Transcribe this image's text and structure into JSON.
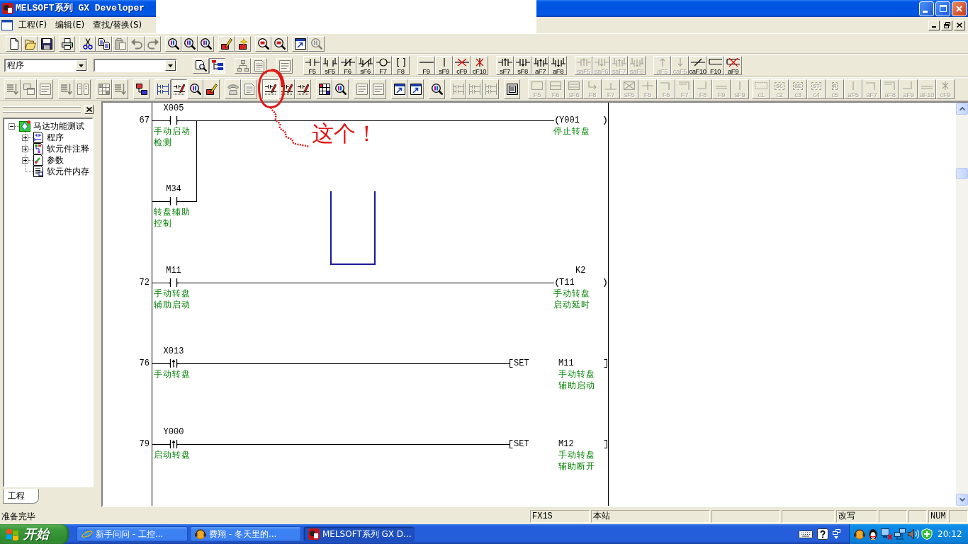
{
  "window": {
    "title": "MELSOFT系列 GX Developer"
  },
  "menu": [
    {
      "label": "工程(F)"
    },
    {
      "label": "编辑(E)"
    },
    {
      "label": "查找/替换(S)"
    }
  ],
  "toolbar_1": [
    [
      {
        "kind": "page",
        "disabled": false,
        "pressed": false
      },
      {
        "kind": "folder",
        "disabled": false,
        "pressed": false
      },
      {
        "kind": "floppy",
        "disabled": false,
        "pressed": false
      }
    ],
    [
      {
        "kind": "printer",
        "disabled": false,
        "pressed": false
      }
    ],
    [
      {
        "kind": "scissors",
        "disabled": false,
        "pressed": false
      },
      {
        "kind": "copy",
        "disabled": false,
        "pressed": false
      },
      {
        "kind": "clipboard",
        "disabled": true,
        "pressed": false
      },
      {
        "kind": "undo",
        "disabled": true,
        "pressed": false
      },
      {
        "kind": "redo",
        "disabled": true,
        "pressed": false
      }
    ],
    [
      {
        "kind": "find",
        "disabled": false,
        "pressed": false
      },
      {
        "kind": "find",
        "disabled": false,
        "pressed": false
      },
      {
        "kind": "find",
        "disabled": false,
        "pressed": false
      }
    ],
    [
      {
        "kind": "box-pencil",
        "disabled": false,
        "pressed": false
      },
      {
        "kind": "box-sparkle",
        "disabled": false,
        "pressed": false
      }
    ],
    [
      {
        "kind": "zoom",
        "disabled": false,
        "pressed": false
      },
      {
        "kind": "zoom",
        "disabled": false,
        "pressed": false
      }
    ],
    [
      {
        "kind": "window-arrow",
        "disabled": false,
        "pressed": false
      },
      {
        "kind": "find",
        "disabled": true,
        "pressed": false
      }
    ]
  ],
  "toolbar_2": {
    "dropdowns": [
      {
        "value": "程序"
      }
    ],
    "tools": [
      [
        {
          "kind": "page-magnifier",
          "disabled": false,
          "pressed": false
        },
        {
          "kind": "tree",
          "disabled": false,
          "pressed": true
        }
      ],
      [
        {
          "kind": "network",
          "disabled": true,
          "pressed": false
        },
        {
          "kind": "document",
          "disabled": true,
          "pressed": false
        }
      ],
      [
        {
          "kind": "list",
          "disabled": true,
          "pressed": false
        }
      ]
    ],
    "keys": [
      [
        {
          "label": "F5",
          "kind": "contact",
          "disabled": false
        },
        {
          "label": "sF5",
          "kind": "parallel-contact",
          "disabled": false
        },
        {
          "label": "F6",
          "kind": "nc",
          "disabled": false
        },
        {
          "label": "sF6",
          "kind": "parallel-nc",
          "disabled": false
        },
        {
          "label": "F7",
          "kind": "coil",
          "disabled": false
        },
        {
          "label": "F8",
          "kind": "brackets",
          "disabled": false
        }
      ],
      [
        {
          "label": "F9",
          "kind": "hline",
          "disabled": false
        },
        {
          "label": "sF9",
          "kind": "vline",
          "disabled": false
        },
        {
          "label": "cF9",
          "kind": "del-hline",
          "disabled": false
        },
        {
          "label": "cF10",
          "kind": "del-vline",
          "disabled": false
        }
      ],
      [
        {
          "label": "sF7",
          "kind": "rise",
          "disabled": false
        },
        {
          "label": "sF8",
          "kind": "fall",
          "disabled": false
        },
        {
          "label": "aF7",
          "kind": "parallel-rise",
          "disabled": false
        },
        {
          "label": "aF8",
          "kind": "parallel-fall",
          "disabled": false
        }
      ],
      [
        {
          "label": "saF5",
          "kind": "rise",
          "disabled": true
        },
        {
          "label": "saF6",
          "kind": "fall",
          "disabled": true
        },
        {
          "label": "saF7",
          "kind": "parallel-rise",
          "disabled": true
        },
        {
          "label": "saF8",
          "kind": "parallel-fall",
          "disabled": true
        }
      ],
      [
        {
          "label": "aF5",
          "kind": "up",
          "disabled": true
        },
        {
          "label": "caF5",
          "kind": "down",
          "disabled": true
        },
        {
          "label": "caF10",
          "kind": "slant",
          "disabled": false
        },
        {
          "label": "F10",
          "kind": "rung",
          "disabled": false
        },
        {
          "label": "aF9",
          "kind": "del-rung",
          "disabled": false
        }
      ]
    ]
  },
  "toolbar_3": {
    "tools": [
      [
        {
          "kind": "list-arrow",
          "disabled": true,
          "pressed": false
        },
        {
          "kind": "windows",
          "disabled": true,
          "pressed": false
        },
        {
          "kind": "list",
          "disabled": true,
          "pressed": false
        }
      ],
      [
        {
          "kind": "list-arrow",
          "disabled": true,
          "pressed": false
        },
        {
          "kind": "columns",
          "disabled": true,
          "pressed": false
        }
      ],
      [
        {
          "kind": "grid",
          "disabled": true,
          "pressed": false
        },
        {
          "kind": "list-arrow",
          "disabled": true,
          "pressed": false
        }
      ],
      [
        {
          "kind": "boxes",
          "disabled": false,
          "pressed": false
        }
      ],
      [
        {
          "kind": "ladder",
          "disabled": false,
          "pressed": false
        },
        {
          "kind": "ladder-pencil",
          "disabled": false,
          "pressed": true
        },
        {
          "kind": "find",
          "disabled": false,
          "pressed": false
        },
        {
          "kind": "box-pencil",
          "disabled": false,
          "pressed": false
        }
      ],
      [
        {
          "kind": "phone",
          "disabled": true,
          "pressed": false
        },
        {
          "kind": "document",
          "disabled": true,
          "pressed": false
        }
      ],
      [
        {
          "kind": "ladder-pencil",
          "disabled": false,
          "pressed": true
        },
        {
          "kind": "ladder-pencil",
          "disabled": false,
          "pressed": false
        },
        {
          "kind": "ladder-pencil",
          "disabled": false,
          "pressed": false
        }
      ],
      [
        {
          "kind": "grid",
          "disabled": false,
          "pressed": false
        },
        {
          "kind": "find",
          "disabled": false,
          "pressed": false
        }
      ],
      [
        {
          "kind": "list",
          "disabled": true,
          "pressed": false
        },
        {
          "kind": "list",
          "disabled": true,
          "pressed": false
        }
      ],
      [
        {
          "kind": "window-arrow",
          "disabled": false,
          "pressed": false
        },
        {
          "kind": "window-arrow",
          "disabled": false,
          "pressed": false
        }
      ],
      [
        {
          "kind": "find",
          "disabled": false,
          "pressed": false
        }
      ],
      [
        {
          "kind": "ladder",
          "disabled": true,
          "pressed": false
        },
        {
          "kind": "ladder",
          "disabled": true,
          "pressed": false
        },
        {
          "kind": "ladder",
          "disabled": true,
          "pressed": false
        }
      ],
      [
        {
          "kind": "monitor",
          "disabled": false,
          "pressed": false
        }
      ]
    ],
    "keys": [
      [
        {
          "label": "F5",
          "kind": "box",
          "disabled": true
        },
        {
          "label": "F6",
          "kind": "box-split",
          "disabled": true
        },
        {
          "label": "sF6",
          "kind": "box-lines",
          "disabled": true
        },
        {
          "label": "F8",
          "kind": "corner-arrow",
          "disabled": true
        },
        {
          "label": "F7",
          "kind": "tee",
          "disabled": true
        },
        {
          "label": "sF5",
          "kind": "box-cross",
          "disabled": true
        },
        {
          "label": "F5",
          "kind": "plus",
          "disabled": true
        },
        {
          "label": "F6",
          "kind": "corner",
          "disabled": true
        },
        {
          "label": "F7",
          "kind": "corner-double",
          "disabled": true
        },
        {
          "label": "F8",
          "kind": "corner-bottom",
          "disabled": true
        },
        {
          "label": "F9",
          "kind": "hline-double",
          "disabled": true
        },
        {
          "label": "sF9",
          "kind": "vline",
          "disabled": true
        }
      ],
      [
        {
          "label": "c1",
          "kind": "dashed",
          "disabled": true
        },
        {
          "label": "c2",
          "kind": "tag",
          "tag": "SC",
          "disabled": true
        },
        {
          "label": "c3",
          "kind": "tag",
          "tag": "SE",
          "disabled": true
        },
        {
          "label": "c4",
          "kind": "tag",
          "tag": "ST",
          "disabled": true
        },
        {
          "label": "c5",
          "kind": "tag",
          "tag": "R",
          "disabled": true
        },
        {
          "label": "aF5",
          "kind": "vline",
          "disabled": true
        },
        {
          "label": "aF7",
          "kind": "corner",
          "disabled": true
        },
        {
          "label": "aF8",
          "kind": "corner-double",
          "disabled": true
        },
        {
          "label": "aF9",
          "kind": "corner-bottom",
          "disabled": true
        },
        {
          "label": "aF10",
          "kind": "hline-double",
          "disabled": true
        },
        {
          "label": "cF9",
          "kind": "cross",
          "disabled": true
        }
      ]
    ]
  },
  "annotation": {
    "text": "这个！"
  },
  "project_panel": {
    "tree": [
      {
        "label": "马达功能测试",
        "kind": "project",
        "expanded": true,
        "children": [
          {
            "label": "程序",
            "kind": "program",
            "expanded": false
          },
          {
            "label": "软元件注释",
            "kind": "comment",
            "expanded": false
          },
          {
            "label": "参数",
            "kind": "parameter",
            "expanded": false
          },
          {
            "label": "软元件内存",
            "kind": "memory"
          }
        ]
      }
    ],
    "tabs": [
      {
        "label": "工程",
        "selected": true
      }
    ]
  },
  "ladder": {
    "rungs": [
      {
        "step": "67",
        "contacts": [
          {
            "kind": "open",
            "device": "X005",
            "comment": "手动启动检测"
          }
        ],
        "branches": [
          {
            "kind": "open",
            "device": "M34",
            "comment": "转盘辅助控制"
          }
        ],
        "output": {
          "kind": "coil",
          "device": "Y001",
          "comment": "停止转盘"
        }
      },
      {
        "step": "72",
        "contacts": [
          {
            "kind": "open",
            "device": "M11",
            "comment": "手动转盘辅助启动"
          }
        ],
        "output": {
          "kind": "coil",
          "device": "T11",
          "setting": "K2",
          "comment": "手动转盘启动延时"
        }
      },
      {
        "step": "76",
        "contacts": [
          {
            "kind": "rising",
            "device": "X013",
            "comment": "手动转盘"
          }
        ],
        "output": {
          "kind": "instruction",
          "instruction": "SET",
          "device": "M11",
          "comment": "手动转盘辅助启动"
        }
      },
      {
        "step": "79",
        "contacts": [
          {
            "kind": "rising",
            "device": "Y000",
            "comment": "启动转盘"
          }
        ],
        "output": {
          "kind": "instruction",
          "instruction": "SET",
          "device": "M12",
          "comment": "手动转盘辅助断开"
        }
      }
    ]
  },
  "status_bar": {
    "message": "准备完毕",
    "panels": [
      {
        "text": "FX1S"
      },
      {
        "text": "本站"
      },
      {
        "text": "改写"
      },
      {
        "text": "NUM"
      }
    ]
  },
  "taskbar": {
    "start": "开始",
    "tasks": [
      {
        "label": "新手问问 - 工控...",
        "kind": "browser",
        "selected": false
      },
      {
        "label": "费翔 - 冬天里的...",
        "kind": "chat",
        "selected": false
      },
      {
        "label": "MELSOFT系列 GX D...",
        "kind": "app",
        "selected": true
      }
    ],
    "clock": "20:12"
  }
}
